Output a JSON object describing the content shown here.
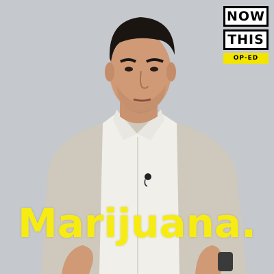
{
  "logo": {
    "line1": "NOW",
    "line2": "THIS",
    "tag": "OP-ED"
  },
  "caption": "Marijuana.",
  "colors": {
    "background": "#c5c8cd",
    "caption": "#f7ec12",
    "logo_tag": "#f2e500"
  }
}
